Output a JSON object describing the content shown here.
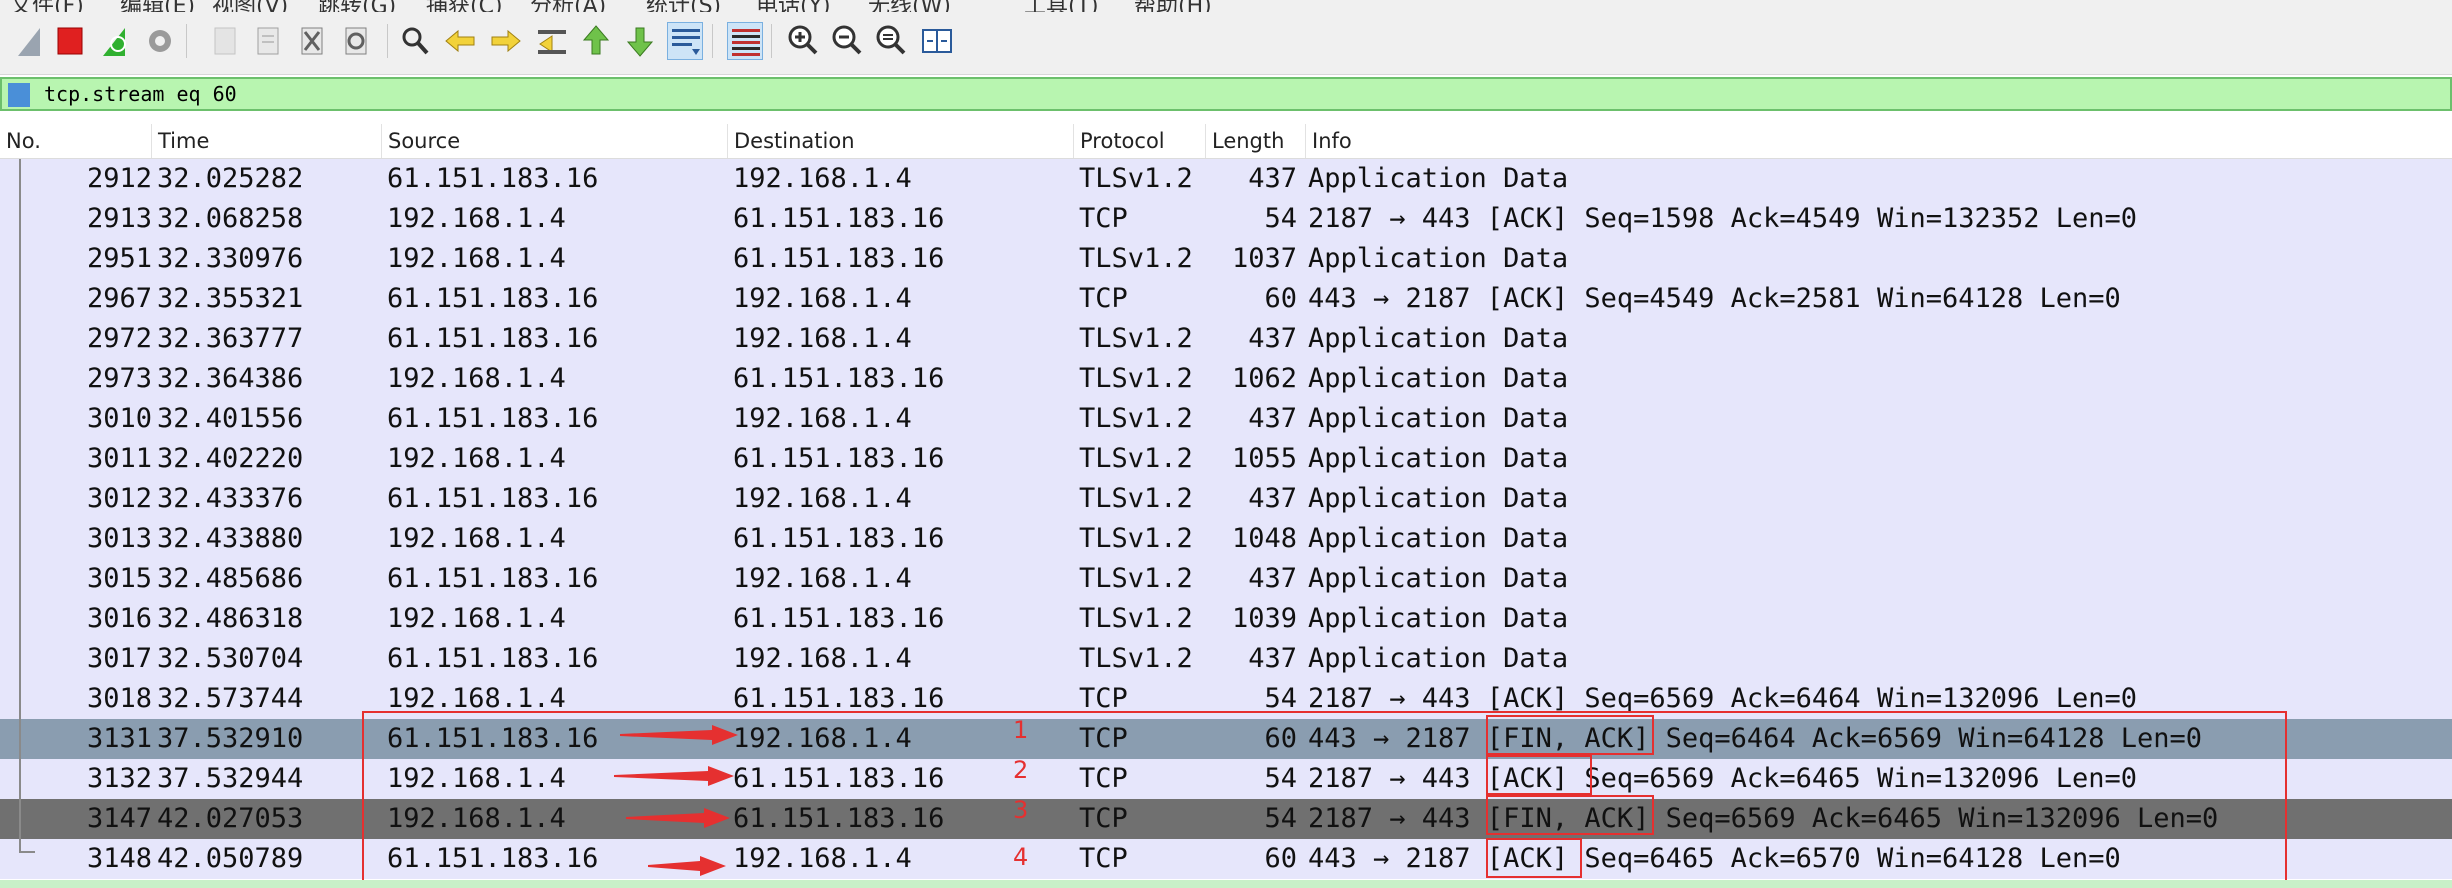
{
  "menu": [
    "文件(F)",
    "编辑(E)",
    "视图(V)",
    "跳转(G)",
    "捕获(C)",
    "分析(A)",
    "统计(S)",
    "电话(Y)",
    "无线(W)",
    "工具(T)",
    "帮助(H)"
  ],
  "filter": {
    "value": "tcp.stream eq 60"
  },
  "columns": [
    "No.",
    "Time",
    "Source",
    "Destination",
    "Protocol",
    "Length",
    "Info"
  ],
  "packets": [
    {
      "no": "2912",
      "time": "32.025282",
      "src": "61.151.183.16",
      "dst": "192.168.1.4",
      "proto": "TLSv1.2",
      "len": "437",
      "info": "Application Data"
    },
    {
      "no": "2913",
      "time": "32.068258",
      "src": "192.168.1.4",
      "dst": "61.151.183.16",
      "proto": "TCP",
      "len": "54",
      "info": "2187 → 443 [ACK] Seq=1598 Ack=4549 Win=132352 Len=0"
    },
    {
      "no": "2951",
      "time": "32.330976",
      "src": "192.168.1.4",
      "dst": "61.151.183.16",
      "proto": "TLSv1.2",
      "len": "1037",
      "info": "Application Data"
    },
    {
      "no": "2967",
      "time": "32.355321",
      "src": "61.151.183.16",
      "dst": "192.168.1.4",
      "proto": "TCP",
      "len": "60",
      "info": "443 → 2187 [ACK] Seq=4549 Ack=2581 Win=64128 Len=0"
    },
    {
      "no": "2972",
      "time": "32.363777",
      "src": "61.151.183.16",
      "dst": "192.168.1.4",
      "proto": "TLSv1.2",
      "len": "437",
      "info": "Application Data"
    },
    {
      "no": "2973",
      "time": "32.364386",
      "src": "192.168.1.4",
      "dst": "61.151.183.16",
      "proto": "TLSv1.2",
      "len": "1062",
      "info": "Application Data"
    },
    {
      "no": "3010",
      "time": "32.401556",
      "src": "61.151.183.16",
      "dst": "192.168.1.4",
      "proto": "TLSv1.2",
      "len": "437",
      "info": "Application Data"
    },
    {
      "no": "3011",
      "time": "32.402220",
      "src": "192.168.1.4",
      "dst": "61.151.183.16",
      "proto": "TLSv1.2",
      "len": "1055",
      "info": "Application Data"
    },
    {
      "no": "3012",
      "time": "32.433376",
      "src": "61.151.183.16",
      "dst": "192.168.1.4",
      "proto": "TLSv1.2",
      "len": "437",
      "info": "Application Data"
    },
    {
      "no": "3013",
      "time": "32.433880",
      "src": "192.168.1.4",
      "dst": "61.151.183.16",
      "proto": "TLSv1.2",
      "len": "1048",
      "info": "Application Data"
    },
    {
      "no": "3015",
      "time": "32.485686",
      "src": "61.151.183.16",
      "dst": "192.168.1.4",
      "proto": "TLSv1.2",
      "len": "437",
      "info": "Application Data"
    },
    {
      "no": "3016",
      "time": "32.486318",
      "src": "192.168.1.4",
      "dst": "61.151.183.16",
      "proto": "TLSv1.2",
      "len": "1039",
      "info": "Application Data"
    },
    {
      "no": "3017",
      "time": "32.530704",
      "src": "61.151.183.16",
      "dst": "192.168.1.4",
      "proto": "TLSv1.2",
      "len": "437",
      "info": "Application Data"
    },
    {
      "no": "3018",
      "time": "32.573744",
      "src": "192.168.1.4",
      "dst": "61.151.183.16",
      "proto": "TCP",
      "len": "54",
      "info": "2187 → 443 [ACK] Seq=6569 Ack=6464 Win=132096 Len=0"
    },
    {
      "no": "3131",
      "time": "37.532910",
      "src": "61.151.183.16",
      "dst": "192.168.1.4",
      "proto": "TCP",
      "len": "60",
      "info": "443 → 2187 [FIN, ACK] Seq=6464 Ack=6569 Win=64128 Len=0"
    },
    {
      "no": "3132",
      "time": "37.532944",
      "src": "192.168.1.4",
      "dst": "61.151.183.16",
      "proto": "TCP",
      "len": "54",
      "info": "2187 → 443 [ACK] Seq=6569 Ack=6465 Win=132096 Len=0"
    },
    {
      "no": "3147",
      "time": "42.027053",
      "src": "192.168.1.4",
      "dst": "61.151.183.16",
      "proto": "TCP",
      "len": "54",
      "info": "2187 → 443 [FIN, ACK] Seq=6569 Ack=6465 Win=132096 Len=0"
    },
    {
      "no": "3148",
      "time": "42.050789",
      "src": "61.151.183.16",
      "dst": "192.168.1.4",
      "proto": "TCP",
      "len": "60",
      "info": "443 → 2187 [ACK] Seq=6465 Ack=6570 Win=64128 Len=0"
    }
  ],
  "annotations": {
    "labels": [
      "1",
      "2",
      "3",
      "4"
    ],
    "color": "#e53030"
  },
  "toolbar_icons": [
    "shark-fin-start-icon",
    "stop-icon",
    "restart-icon",
    "options-gear-icon",
    "open-file-icon",
    "save-file-icon",
    "close-file-icon",
    "reload-icon",
    "find-icon",
    "go-back-icon",
    "go-forward-icon",
    "go-to-packet-icon",
    "first-packet-icon",
    "last-packet-icon",
    "autoscroll-icon",
    "colorize-icon",
    "zoom-in-icon",
    "zoom-out-icon",
    "zoom-normal-icon",
    "resize-columns-icon"
  ],
  "colors": {
    "row_bg": "#e6e6fb",
    "selected_row": "#8a9db0",
    "focus_row": "#707070",
    "filter_bg": "#b8f5b0"
  }
}
